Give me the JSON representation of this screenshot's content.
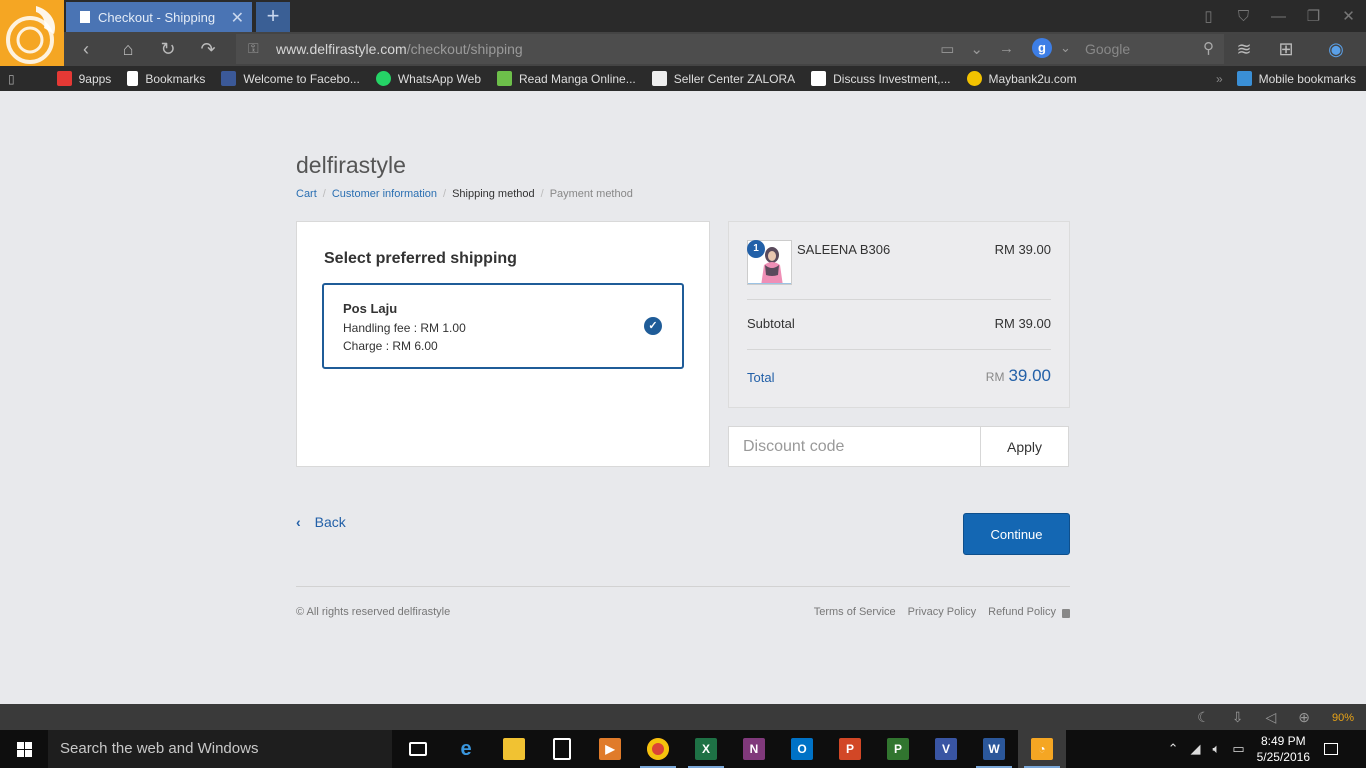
{
  "browser": {
    "tab_title": "Checkout - Shipping m",
    "url_domain": "www.delfirastyle.com",
    "url_path": "/checkout/shipping",
    "search_engine_badge": "g",
    "search_placeholder": "Google",
    "bookmarks": [
      {
        "label": "9apps",
        "color": "#e53935"
      },
      {
        "label": "Bookmarks",
        "color": "#ffffff"
      },
      {
        "label": "Welcome to Facebo...",
        "color": "#3b5998"
      },
      {
        "label": "WhatsApp Web",
        "color": "#25d366"
      },
      {
        "label": "Read Manga Online...",
        "color": "#6dbf4a"
      },
      {
        "label": "Seller Center ZALORA",
        "color": "#eeeeee"
      },
      {
        "label": "Discuss Investment,...",
        "color": "#ffffff"
      },
      {
        "label": "Maybank2u.com",
        "color": "#f2c200"
      }
    ],
    "mobile_bookmarks": "Mobile bookmarks",
    "zoom": "90%"
  },
  "checkout": {
    "shop_name": "delfirastyle",
    "breadcrumb": {
      "cart": "Cart",
      "customer_information": "Customer information",
      "shipping_method": "Shipping method",
      "payment_method": "Payment method",
      "separator": "/"
    },
    "shipping_heading": "Select preferred shipping",
    "option": {
      "name": "Pos Laju",
      "handling_fee": "Handling fee : RM 1.00",
      "charge": "Charge : RM 6.00",
      "selected": true
    },
    "summary": {
      "quantity": "1",
      "product_name": "SALEENA B306",
      "product_price": "RM 39.00",
      "subtotal_label": "Subtotal",
      "subtotal_value": "RM 39.00",
      "total_label": "Total",
      "total_currency": "RM",
      "total_amount": "39.00"
    },
    "discount_placeholder": "Discount code",
    "apply_label": "Apply",
    "back_label": "Back",
    "continue_label": "Continue",
    "copyright": "© All rights reserved delfirastyle",
    "footer_links": [
      "Terms of Service",
      "Privacy Policy",
      "Refund Policy"
    ]
  },
  "taskbar": {
    "search_placeholder": "Search the web and Windows",
    "time": "8:49 PM",
    "date": "5/25/2016"
  },
  "colors": {
    "accent": "#1467b3",
    "link": "#2260a8",
    "logo": "#f5a623",
    "active_tab": "#4a74b4"
  }
}
